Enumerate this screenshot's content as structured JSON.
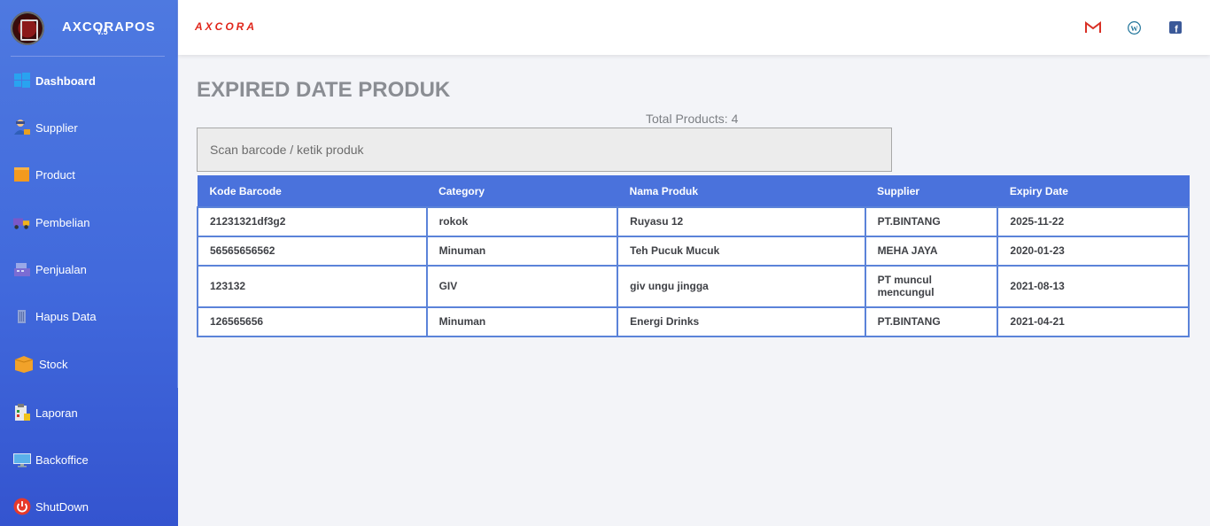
{
  "app": {
    "name": "AXCORAPOS",
    "version": "V.5",
    "topbar_brand": "AXCORA"
  },
  "sidebar": {
    "items": [
      {
        "label": "Dashboard",
        "icon": "windows-icon",
        "active": true
      },
      {
        "label": "Supplier",
        "icon": "supplier-person-icon"
      },
      {
        "label": "Product",
        "icon": "product-box-icon"
      },
      {
        "label": "Pembelian",
        "icon": "truck-icon"
      },
      {
        "label": "Penjualan",
        "icon": "cash-register-icon"
      },
      {
        "label": "Hapus Data",
        "icon": "trash-icon"
      },
      {
        "label": "Stock",
        "icon": "stock-box-icon"
      },
      {
        "label": "Laporan",
        "icon": "report-clipboard-icon"
      },
      {
        "label": "Backoffice",
        "icon": "monitor-icon"
      },
      {
        "label": "ShutDown",
        "icon": "power-icon"
      }
    ]
  },
  "topbar": {
    "icons": [
      "gmail-icon",
      "wordpress-icon",
      "facebook-icon"
    ]
  },
  "page": {
    "title": "EXPIRED DATE PRODUK",
    "total_label": "Total Products:",
    "total_value": "4",
    "search_placeholder": "Scan barcode / ketik produk"
  },
  "table": {
    "headers": [
      "Kode Barcode",
      "Category",
      "Nama Produk",
      "Supplier",
      "Expiry Date"
    ],
    "rows": [
      [
        "21231321df3g2",
        "rokok",
        "Ruyasu 12",
        "PT.BINTANG",
        "2025-11-22"
      ],
      [
        "56565656562",
        "Minuman",
        "Teh Pucuk Mucuk",
        "MEHA JAYA",
        "2020-01-23"
      ],
      [
        "123132",
        "GIV",
        "giv ungu jingga",
        "PT muncul mencungul",
        "2021-08-13"
      ],
      [
        "126565656",
        "Minuman",
        "Energi Drinks",
        "PT.BINTANG",
        "2021-04-21"
      ]
    ]
  },
  "colors": {
    "sidebar": "#4169dc",
    "header_row": "#4a72dc",
    "brand_red": "#e0261b"
  }
}
